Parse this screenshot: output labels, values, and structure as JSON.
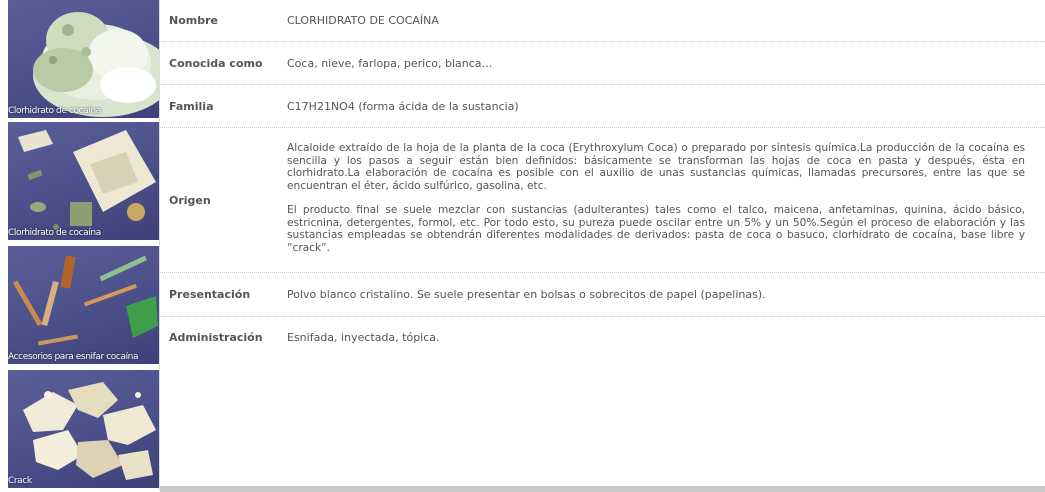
{
  "images": [
    {
      "caption": "Clorhidrato de cocaína",
      "icon": "cocaine-powder-image"
    },
    {
      "caption": "Clorhidrato de cocaína",
      "icon": "cocaine-packets-image"
    },
    {
      "caption": "Accesorios para esnifar cocaína",
      "icon": "snorting-accessories-image"
    },
    {
      "caption": "Crack",
      "icon": "crack-rocks-image"
    }
  ],
  "rows": [
    {
      "label": "Nombre",
      "value": "CLORHIDRATO DE COCAÍNA"
    },
    {
      "label": "Conocida como",
      "value": "Coca, nieve, farlopa, perico, blanca…"
    },
    {
      "label": "Familia",
      "value": "C17H21NO4 (forma ácida de la sustancia)"
    },
    {
      "label": "Origen",
      "paragraphs": [
        "Alcaloide extraído de la hoja de la planta de la coca (Erythroxylum Coca) o preparado por síntesis química.La producción de la cocaína es sencilla y los pasos a seguir están bien definidos: básicamente se transforman las hojas de coca en pasta y después, ésta en clorhidrato.La elaboración de cocaína es posible con el auxilio de unas sustancias químicas, llamadas precursores, entre las que se encuentran el éter, ácido sulfúrico, gasolina, etc.",
        "El producto final se suele mezclar con sustancias (adulterantes) tales como el talco, maicena, anfetaminas, quinina, ácido básico, estricnina, detergentes, formol, etc. Por todo esto, su pureza puede oscilar entre un 5% y un 50%.Según el proceso de elaboración y las sustancias empleadas se obtendrán diferentes modalidades de derivados: pasta de coca o basuco, clorhidrato de cocaína, base libre y “crack”."
      ]
    },
    {
      "label": "Presentación",
      "value": "Polvo blanco cristalino. Se suele presentar en bolsas o sobrecitos de papel (papelinas)."
    },
    {
      "label": "Administración",
      "value": "Esnifada, inyectada, tópica."
    }
  ]
}
